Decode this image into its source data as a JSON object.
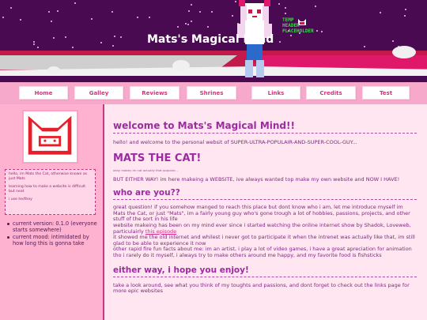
{
  "header": {
    "site_title": "Mats's Magical Mind",
    "badge_lines": [
      "TEMP",
      "HEADER",
      "PLACEHOLDER"
    ]
  },
  "nav": {
    "items": [
      {
        "label": "Home"
      },
      {
        "label": "Galley"
      },
      {
        "label": "Reviews"
      },
      {
        "label": "Shrines"
      },
      {
        "label": "Links"
      },
      {
        "label": "Credits"
      },
      {
        "label": "Test"
      }
    ]
  },
  "sidebar": {
    "bio": [
      "hello, im Mats the Cat, otherwise known as just Mats",
      "learning how to make a website is difficult but neat",
      "i use he/they"
    ],
    "status": [
      "current version: 0.1.0 (everyone starts somewhere)",
      "current mood: intimidated by how long this is gonna take"
    ]
  },
  "main": {
    "welcome_heading": "welcome to Mats's Magical Mind!!",
    "welcome_text": "hello! and welcome to the personal websit of SUPER-ULTRA-POPULAIR-AND-SUPER-COOL-GUY...",
    "name_heading": "MATS THE CAT!",
    "tiny_note": "okay mabey im not actually that populair...",
    "either_way_text": "BUT EITHER WAY! im here makeing a WEBSITE, ive always wanted top make my own website and NOW I HAVE!",
    "who_heading": "who are you??",
    "who_text_1": "great question! if you somehow manged to reach this place but dont know who i am, let me introduce myself im Mats the Cat, or just \"Mats\", im a fairly young guy who's gone trough a lot of hobbies, passions, projects, and other stuff of the sort in his life",
    "who_text_2_before": "website makeing has been on my mind ever since i started watching the online internet show by Shadok, Loveweb, particulairly ",
    "who_text_2_link": "this episode",
    "who_text_3": "it showed me the old internet and whilest i never got to participate it when the intrenet was actually like that, im still glad to be able to experience it now",
    "who_text_4": "other rapid fire fun facts about me: im an artist, i play a lot of video games, i have a great apreciation for animation tho i rarely do it myself, i always try to make others around me happy, and my favorite food is fishsticks",
    "enjoy_heading": "either way, i hope you enjoy!",
    "enjoy_text": "take a look around, see what you think of my toughts and passions, and dont forget to check out the links page for more epic websites"
  },
  "colors": {
    "accent": "#9a2ca0",
    "nav_text": "#d2357a",
    "page_bg": "#ff9fc8",
    "header_bg": "#4a0a52"
  }
}
